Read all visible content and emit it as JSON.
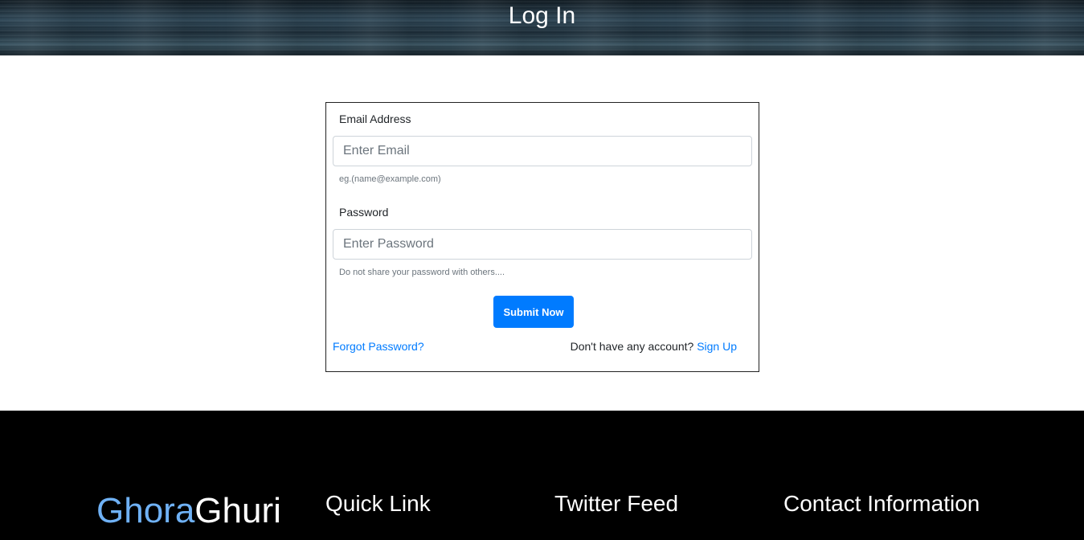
{
  "header": {
    "title": "Log In"
  },
  "form": {
    "email_label": "Email Address",
    "email_placeholder": "Enter Email",
    "email_hint": "eg.(name@example.com)",
    "password_label": "Password",
    "password_placeholder": "Enter Password",
    "password_hint": "Do not share your password with others....",
    "submit_label": "Submit Now",
    "forgot_label": "Forgot Password?",
    "no_account_text": "Don't have any account?",
    "signup_label": "Sign Up"
  },
  "footer": {
    "brand_part1": "Ghora",
    "brand_part2": "Ghuri",
    "headings": [
      "Quick Link",
      "Twitter Feed",
      "Contact Information"
    ]
  },
  "colors": {
    "accent": "#007bff",
    "brand_blue": "#6fb1f5",
    "footer_bg": "#000000"
  }
}
